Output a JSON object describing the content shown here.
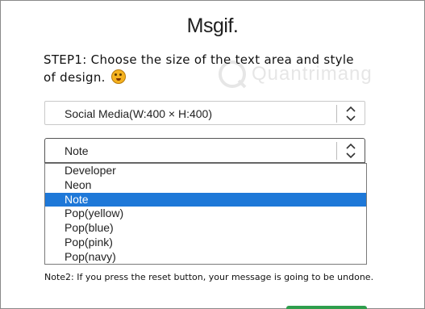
{
  "logo": "Msgif.",
  "step1": "STEP1: Choose the size of the text area and style of design.",
  "size_select": {
    "value": "Social Media(W:400 × H:400)"
  },
  "style_select": {
    "value": "Note"
  },
  "style_options": [
    "Developer",
    "Neon",
    "Note",
    "Pop(yellow)",
    "Pop(blue)",
    "Pop(pink)",
    "Pop(navy)"
  ],
  "selected_option": "Note",
  "note2": "Note2: If you press the reset button, your message is going to be undone.",
  "watermark": "Quantrimang",
  "colors": {
    "highlight": "#1e78d8",
    "button": "#2f9e4d"
  },
  "icons": [
    "chevron-updown-icon",
    "emoji-icon"
  ]
}
